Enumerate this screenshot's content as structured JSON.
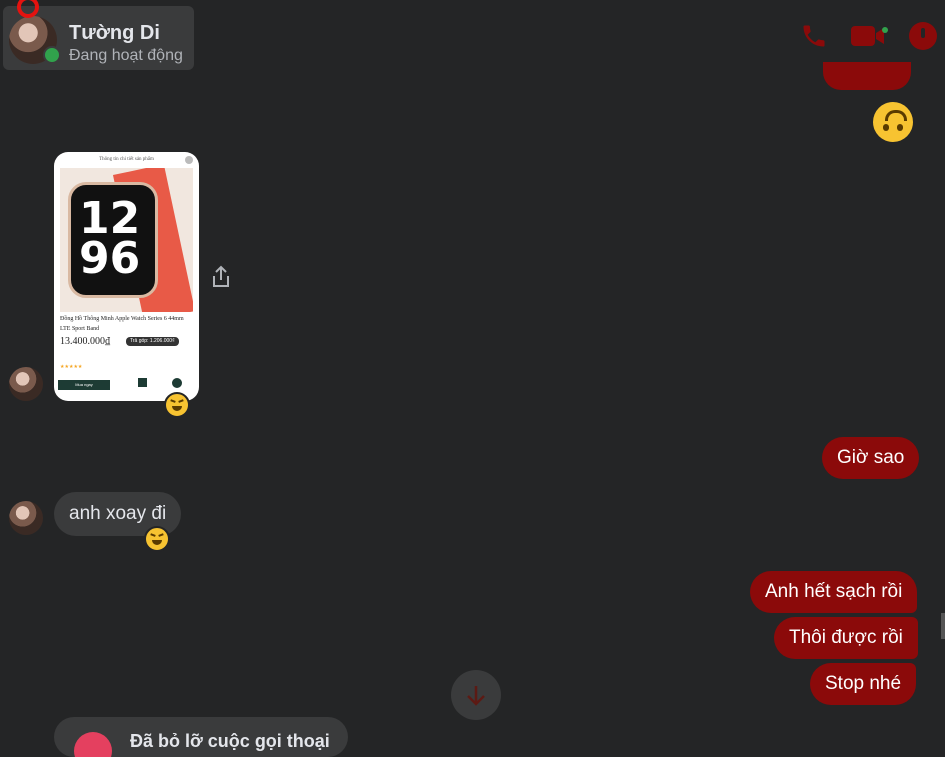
{
  "header": {
    "contact_name": "Tường Di",
    "contact_status": "Đang hoạt động",
    "icons": [
      "phone-icon",
      "video-call-icon",
      "info-icon"
    ],
    "accent_color": "#8b0a0a"
  },
  "messages": [
    {
      "side": "out",
      "type": "emoji",
      "emoji": "upside-down-face"
    },
    {
      "side": "in",
      "type": "product-card",
      "reaction": "grinning-squinting-face",
      "card": {
        "header": "Thông tin chi tiết sản phẩm",
        "watch_face": "12 96",
        "title": "Đồng Hồ Thông Minh Apple Watch Series 6 44mm LTE Sport Band",
        "price": "13.400.000₫",
        "installment": "Trả góp: 1.206.000₫",
        "buy_label": "Mua ngay"
      }
    },
    {
      "side": "out",
      "type": "text",
      "text": "Giờ sao"
    },
    {
      "side": "in",
      "type": "text",
      "text": "anh xoay đi",
      "reaction": "grinning-squinting-face"
    },
    {
      "side": "out",
      "type": "text",
      "text": "Anh hết sạch rồi"
    },
    {
      "side": "out",
      "type": "text",
      "text": "Thôi được rồi"
    },
    {
      "side": "out",
      "type": "text",
      "text": "Stop nhé"
    }
  ],
  "bottom_bar": {
    "text": "Đã bỏ lỡ cuộc gọi thoại"
  }
}
